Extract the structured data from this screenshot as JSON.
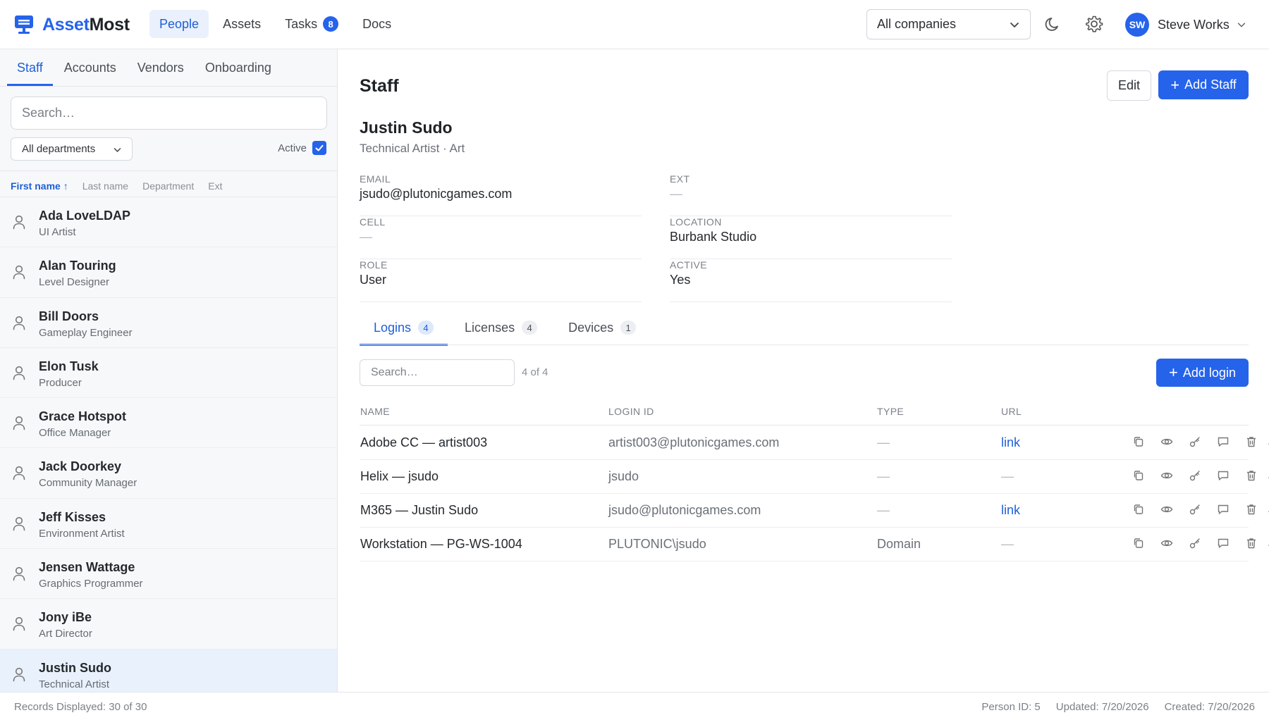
{
  "brand": {
    "name_part1": "Asset",
    "name_part2": "Most"
  },
  "nav": [
    {
      "label": "People",
      "active": true
    },
    {
      "label": "Assets"
    },
    {
      "label": "Tasks",
      "badge": "8"
    },
    {
      "label": "Docs"
    }
  ],
  "company_select": {
    "value": "All companies"
  },
  "user": {
    "initials": "SW",
    "name": "Steve Works"
  },
  "left": {
    "tabs": [
      "Staff",
      "Accounts",
      "Vendors",
      "Onboarding"
    ],
    "search_placeholder": "Search…",
    "department_filter": "All departments",
    "active_label": "Active",
    "sort_columns": [
      "First name ↑",
      "Last name",
      "Department",
      "Ext"
    ],
    "staff": [
      {
        "name": "Ada LoveLDAP",
        "title": "UI Artist"
      },
      {
        "name": "Alan Touring",
        "title": "Level Designer"
      },
      {
        "name": "Bill Doors",
        "title": "Gameplay Engineer"
      },
      {
        "name": "Elon Tusk",
        "title": "Producer"
      },
      {
        "name": "Grace Hotspot",
        "title": "Office Manager"
      },
      {
        "name": "Jack Doorkey",
        "title": "Community Manager"
      },
      {
        "name": "Jeff Kisses",
        "title": "Environment Artist"
      },
      {
        "name": "Jensen Wattage",
        "title": "Graphics Programmer"
      },
      {
        "name": "Jony iBe",
        "title": "Art Director"
      },
      {
        "name": "Justin Sudo",
        "title": "Technical Artist"
      }
    ]
  },
  "main": {
    "title": "Staff",
    "edit_label": "Edit",
    "add_staff_label": "Add Staff",
    "person": {
      "name": "Justin Sudo",
      "subtitle": "Technical Artist · Art"
    },
    "fields": {
      "email": {
        "label": "EMAIL",
        "value": "jsudo@plutonicgames.com"
      },
      "ext": {
        "label": "EXT",
        "value": "—"
      },
      "cell": {
        "label": "CELL",
        "value": "—"
      },
      "location": {
        "label": "LOCATION",
        "value": "Burbank Studio"
      },
      "role": {
        "label": "ROLE",
        "value": "User"
      },
      "active": {
        "label": "ACTIVE",
        "value": "Yes"
      }
    },
    "detail_tabs": [
      {
        "label": "Logins",
        "count": "4",
        "active": true
      },
      {
        "label": "Licenses",
        "count": "4"
      },
      {
        "label": "Devices",
        "count": "1"
      }
    ],
    "logins": {
      "search_placeholder": "Search…",
      "count_text": "4 of 4",
      "add_label": "Add login",
      "columns": [
        "NAME",
        "LOGIN ID",
        "TYPE",
        "URL"
      ],
      "rows": [
        {
          "name": "Adobe CC — artist003",
          "login_id": "artist003@plutonicgames.com",
          "type": "—",
          "url": "link"
        },
        {
          "name": "Helix — jsudo",
          "login_id": "jsudo",
          "type": "—",
          "url": "—"
        },
        {
          "name": "M365 — Justin Sudo",
          "login_id": "jsudo@plutonicgames.com",
          "type": "—",
          "url": "link"
        },
        {
          "name": "Workstation — PG-WS-1004",
          "login_id": "PLUTONIC\\jsudo",
          "type": "Domain",
          "url": "—"
        }
      ],
      "more_label": ".."
    }
  },
  "footer": {
    "records": "Records Displayed: 30 of 30",
    "person_id": "Person ID: 5",
    "updated": "Updated: 7/20/2026",
    "created": "Created: 7/20/2026"
  },
  "colors": {
    "accent": "#2563eb",
    "selected_row": "#e9f1fc"
  },
  "icons": [
    "monitor-logo-icon",
    "chevron-down-icon",
    "moon-icon",
    "gear-icon",
    "person-icon",
    "check-icon",
    "plus-icon",
    "copy-icon",
    "eye-icon",
    "key-icon",
    "comment-icon",
    "trash-icon"
  ]
}
